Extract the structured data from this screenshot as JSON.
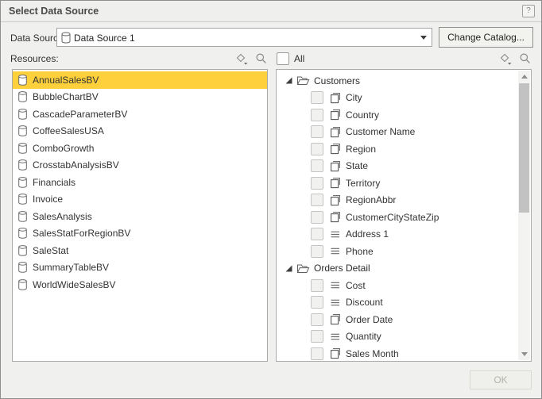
{
  "window": {
    "title": "Select Data Source",
    "help_glyph": "?"
  },
  "datasource": {
    "label": "Data Source:",
    "selected_value": "Data Source 1",
    "change_catalog_button": "Change Catalog..."
  },
  "resources": {
    "label": "Resources:",
    "items": [
      {
        "name": "AnnualSalesBV",
        "selected": true
      },
      {
        "name": "BubbleChartBV",
        "selected": false
      },
      {
        "name": "CascadeParameterBV",
        "selected": false
      },
      {
        "name": "CoffeeSalesUSA",
        "selected": false
      },
      {
        "name": "ComboGrowth",
        "selected": false
      },
      {
        "name": "CrosstabAnalysisBV",
        "selected": false
      },
      {
        "name": "Financials",
        "selected": false
      },
      {
        "name": "Invoice",
        "selected": false
      },
      {
        "name": "SalesAnalysis",
        "selected": false
      },
      {
        "name": "SalesStatForRegionBV",
        "selected": false
      },
      {
        "name": "SaleStat",
        "selected": false
      },
      {
        "name": "SummaryTableBV",
        "selected": false
      },
      {
        "name": "WorldWideSalesBV",
        "selected": false
      }
    ]
  },
  "fields": {
    "all_label": "All",
    "all_checked": false,
    "groups": [
      {
        "label": "Customers",
        "expanded": true,
        "fields": [
          {
            "name": "City",
            "icon": "column",
            "checked": false
          },
          {
            "name": "Country",
            "icon": "column",
            "checked": false
          },
          {
            "name": "Customer Name",
            "icon": "column",
            "checked": false
          },
          {
            "name": "Region",
            "icon": "column",
            "checked": false
          },
          {
            "name": "State",
            "icon": "column",
            "checked": false
          },
          {
            "name": "Territory",
            "icon": "column",
            "checked": false
          },
          {
            "name": "RegionAbbr",
            "icon": "column",
            "checked": false
          },
          {
            "name": "CustomerCityStateZip",
            "icon": "column",
            "checked": false
          },
          {
            "name": "Address 1",
            "icon": "lines",
            "checked": false
          },
          {
            "name": "Phone",
            "icon": "lines",
            "checked": false
          }
        ]
      },
      {
        "label": "Orders Detail",
        "expanded": true,
        "fields": [
          {
            "name": "Cost",
            "icon": "lines",
            "checked": false
          },
          {
            "name": "Discount",
            "icon": "lines",
            "checked": false
          },
          {
            "name": "Order Date",
            "icon": "column",
            "checked": false
          },
          {
            "name": "Quantity",
            "icon": "lines",
            "checked": false
          },
          {
            "name": "Sales Month",
            "icon": "column",
            "checked": false
          }
        ]
      }
    ]
  },
  "footer": {
    "ok_button": "OK",
    "ok_enabled": false
  },
  "colors": {
    "selection_yellow": "#fdd03c",
    "dialog_background": "#f0f0ee",
    "outer_border": "#8e8e8e",
    "disabled_text": "#b3b3ab"
  }
}
